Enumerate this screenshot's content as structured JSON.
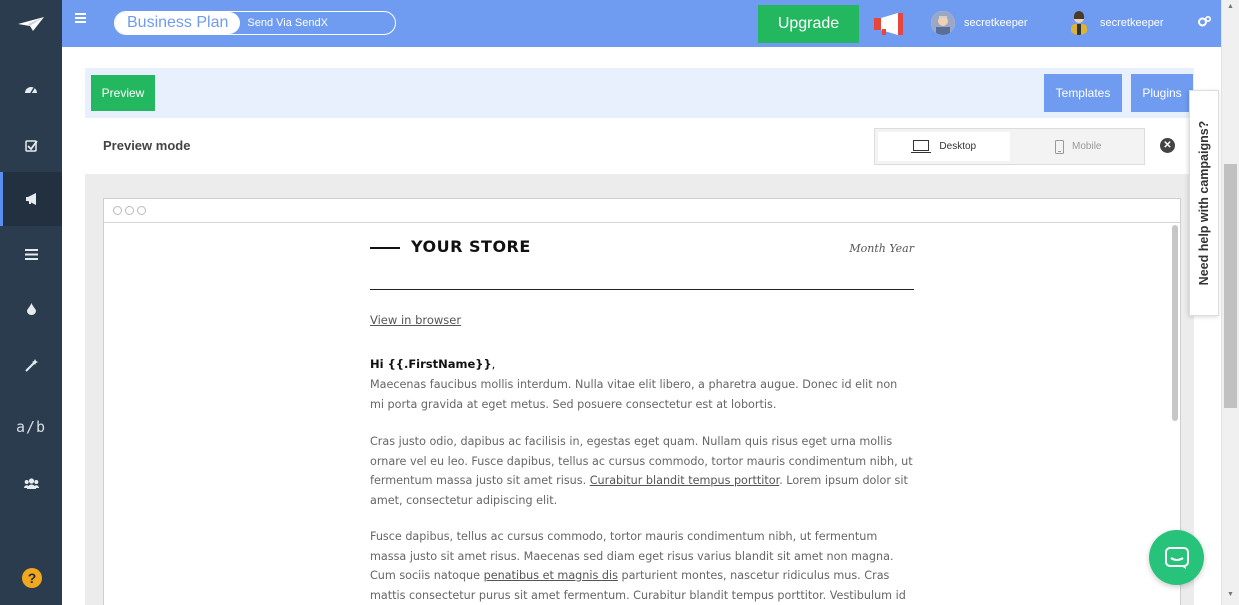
{
  "topbar": {
    "plan_name": "Business Plan",
    "send_link": "Send Via SendX",
    "upgrade_label": "Upgrade",
    "users": [
      {
        "name": "secretkeeper"
      },
      {
        "name": "secretkeeper"
      }
    ]
  },
  "sidebar": {
    "items": [
      {
        "icon": "dashboard-icon"
      },
      {
        "icon": "checkbox-icon"
      },
      {
        "icon": "megaphone-icon",
        "active": true
      },
      {
        "icon": "list-icon"
      },
      {
        "icon": "drop-icon"
      },
      {
        "icon": "magic-wand-icon"
      },
      {
        "label": "a/b"
      },
      {
        "icon": "users-icon"
      }
    ],
    "help_label": "?"
  },
  "toolbar": {
    "preview_label": "Preview",
    "templates_label": "Templates",
    "plugins_label": "Plugins"
  },
  "preview": {
    "title": "Preview mode",
    "desktop_label": "Desktop",
    "mobile_label": "Mobile"
  },
  "email": {
    "store_name": "YOUR STORE",
    "date_label": "Month Year",
    "view_in_browser": "View in browser",
    "greeting": "Hi {{.FirstName}}",
    "greeting_suffix": ",",
    "p1": "Maecenas faucibus mollis interdum. Nulla vitae elit libero, a pharetra augue. Donec id elit non mi porta gravida at eget metus. Sed posuere consectetur est at lobortis.",
    "p2_before": "Cras justo odio, dapibus ac facilisis in, egestas eget quam. Nullam quis risus eget urna mollis ornare vel eu leo. Fusce dapibus, tellus ac cursus commodo, tortor mauris condimentum nibh, ut fermentum massa justo sit amet risus. ",
    "p2_link": "Curabitur blandit tempus porttitor",
    "p2_after": ". Lorem ipsum dolor sit amet, consectetur adipiscing elit.",
    "p3_before": "Fusce dapibus, tellus ac cursus commodo, tortor mauris condimentum nibh, ut fermentum massa justo sit amet risus. Maecenas sed diam eget risus varius blandit sit amet non magna. Cum sociis natoque ",
    "p3_link": "penatibus et magnis dis",
    "p3_after": " parturient montes, nascetur ridiculus mus. Cras mattis consectetur purus sit amet fermentum. Curabitur blandit tempus porttitor. Vestibulum id ligula"
  },
  "help_tab": "Need help with campaigns?",
  "colors": {
    "topbar": "#6f9cf0",
    "sidebar": "#2b3c4e",
    "green": "#23b860"
  }
}
